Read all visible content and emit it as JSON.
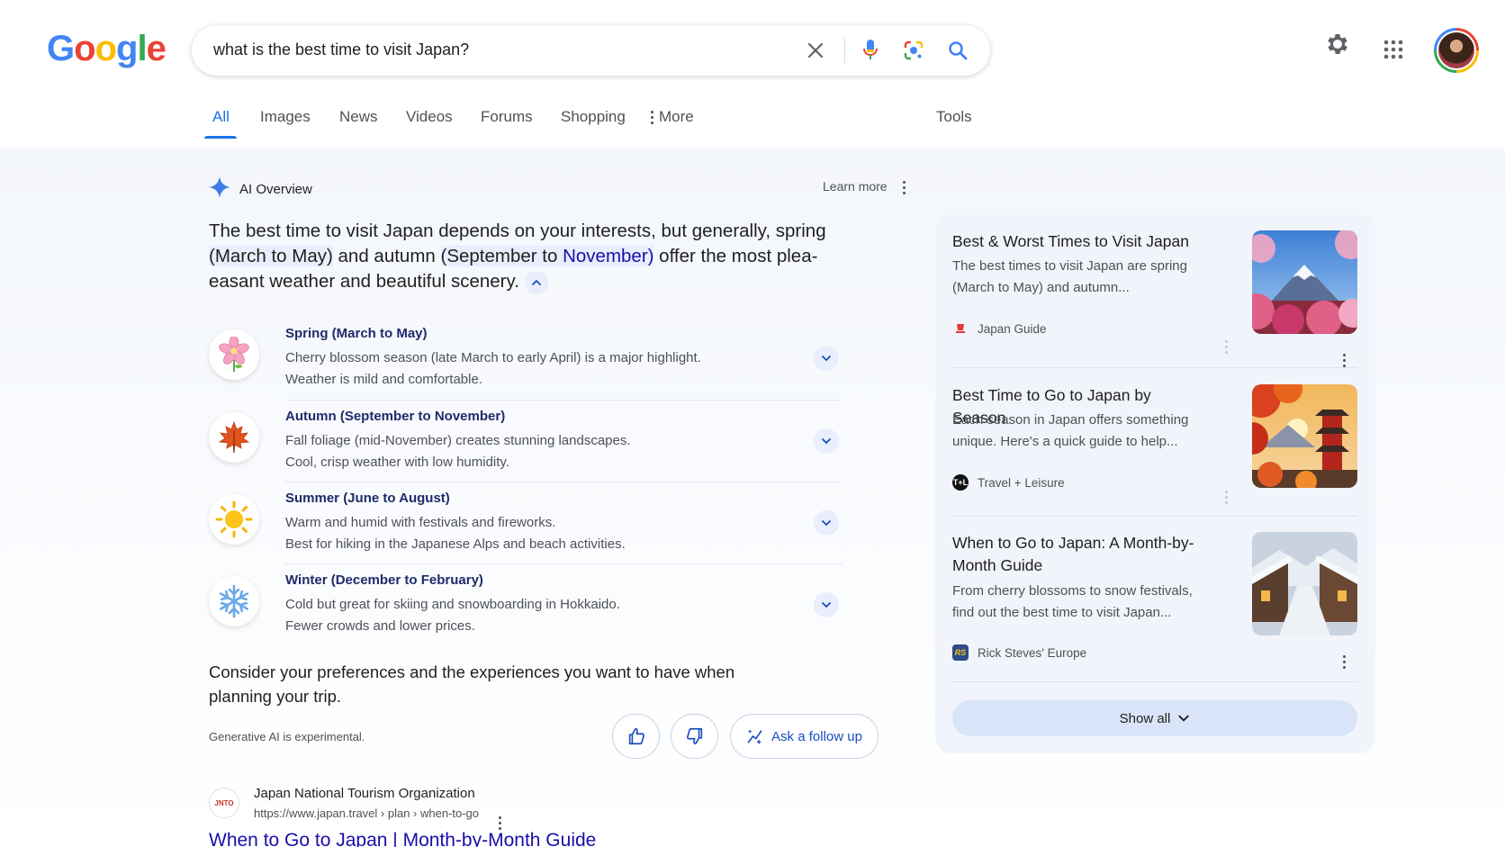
{
  "logo": {
    "letters": [
      "G",
      "o",
      "o",
      "g",
      "l",
      "e"
    ]
  },
  "search": {
    "query": "what is the best time to visit Japan?"
  },
  "icons": {
    "clear": "close-icon",
    "voice": "microphone-icon",
    "lens": "lens-icon",
    "search": "search-icon",
    "settings": "gear-icon",
    "apps": "apps-grid-icon"
  },
  "tabs": [
    {
      "label": "All",
      "active": true
    },
    {
      "label": "Images"
    },
    {
      "label": "News"
    },
    {
      "label": "Videos"
    },
    {
      "label": "Forums"
    },
    {
      "label": "Shopping"
    },
    {
      "label": "More"
    }
  ],
  "tools_label": "Tools",
  "ai_overview": {
    "title": "AI Overview",
    "learn_more": "Learn more",
    "summary": {
      "p1": "The best time to visit Japan depends on your interests, but generally, spring ",
      "h1": "(March to May)",
      "p2": " and autumn ",
      "h2": "(September to ",
      "h3": "November)",
      "p3": " offer the most plea-",
      "p4": "easant weather and beautiful scenery."
    },
    "seasons": [
      {
        "title": "Spring (March to May)",
        "line1": "Cherry blossom season (late March to early April) is a major highlight.",
        "line2": "Weather is mild and comfortable.",
        "icon": "cherry-blossom-icon"
      },
      {
        "title": "Autumn (September to November)",
        "line1": "Fall foliage (mid-November) creates stunning landscapes.",
        "line2": "Cool, crisp weather with low humidity.",
        "icon": "maple-leaf-icon"
      },
      {
        "title": "Summer (June to August)",
        "line1": "Warm and humid with festivals and fireworks.",
        "line2": "Best for hiking in the Japanese Alps and beach activities.",
        "icon": "sun-icon"
      },
      {
        "title": "Winter (December to February)",
        "line1": "Cold but great for skiing and snowboarding in Hokkaido.",
        "line2": "Fewer crowds and lower prices.",
        "icon": "snowflake-icon"
      }
    ],
    "consider": "Consider your preferences and the experiences you want to have when planning your trip.",
    "disclaimer": "Generative AI is experimental.",
    "follow_up": "Ask a follow up"
  },
  "sources": [
    {
      "title": "Best & Worst Times to Visit Japan",
      "snippet": "The best times to visit Japan are spring (March to May) and autumn...",
      "publisher": "Japan Guide",
      "pub_color": "#e53935"
    },
    {
      "title": "Best Time to Go to Japan by Season",
      "snippet": "Each season in Japan offers something unique. Here's a quick guide to help...",
      "publisher": "Travel + Leisure",
      "pub_color": "#111111"
    },
    {
      "title": "When to Go to Japan: A Month-by-Month Guide",
      "snippet": "From cherry blossoms to snow festivals, find out the best time to visit Japan...",
      "publisher": "Rick Steves' Europe",
      "pub_color": "#2c4a8c"
    }
  ],
  "show_all": "Show all",
  "result": {
    "site": "Japan National Tourism Organization",
    "url": "https://www.japan.travel › plan › when-to-go",
    "title": "When to Go to Japan | Month-by-Month Guide",
    "favicon_text": "JNTO"
  }
}
